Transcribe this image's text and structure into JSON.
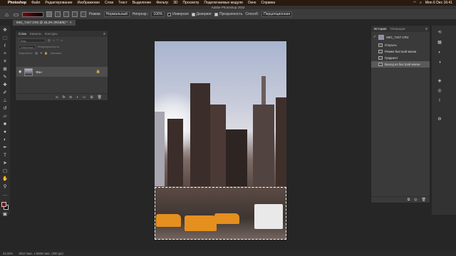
{
  "menubar": {
    "app": "Photoshop",
    "items": [
      "Файл",
      "Редактирование",
      "Изображение",
      "Слои",
      "Текст",
      "Выделение",
      "Фильтр",
      "3D",
      "Просмотр",
      "Подключаемые модули",
      "Окно",
      "Справка"
    ],
    "clock": "Mon 6 Dec  16:41"
  },
  "window": {
    "title": "Adobe Photoshop 2022"
  },
  "options": {
    "mode_label": "Режим:",
    "mode_value": "Нормальный",
    "opacity_label": "Непрозр.:",
    "opacity_value": "100%",
    "checks": [
      {
        "label": "Инверсия",
        "checked": false
      },
      {
        "label": "Дизеринг",
        "checked": true
      },
      {
        "label": "Прозрачность",
        "checked": true
      }
    ],
    "method_label": "Способ:",
    "method_value": "Перцепционная"
  },
  "document": {
    "tab_title": "IMG_7447.CR2 @ 33,3% (RGB/8) *",
    "close": "×"
  },
  "layers_panel": {
    "tabs": [
      "Слои",
      "Каналы",
      "Контуры"
    ],
    "active_tab": 0,
    "search_placeholder": "Вид",
    "blend_mode": "Обычные",
    "opacity_label": "Непрозрачность:",
    "lock_label": "Закрепить:",
    "fill_label": "Заливка:",
    "layers": [
      {
        "name": "Фон",
        "locked": true,
        "visible": true
      }
    ],
    "footer_icons": [
      "link-icon",
      "fx-icon",
      "mask-icon",
      "adjustment-icon",
      "folder-icon",
      "new-layer-icon",
      "trash-icon"
    ]
  },
  "history_panel": {
    "tabs": [
      "История",
      "Операции"
    ],
    "active_tab": 0,
    "snapshot": "IMG_7447.CR2",
    "items": [
      {
        "label": "Открыть",
        "active": false
      },
      {
        "label": "Режим быстрой маски",
        "active": false
      },
      {
        "label": "Градиент",
        "active": false
      },
      {
        "label": "Выход из быстрой маски",
        "active": true
      }
    ]
  },
  "status": {
    "zoom": "33,33%",
    "info": "3912 пикс. x 5568 пикс. (300 ppi)"
  },
  "colors": {
    "foreground": "#8b0000",
    "background": "#000000"
  }
}
